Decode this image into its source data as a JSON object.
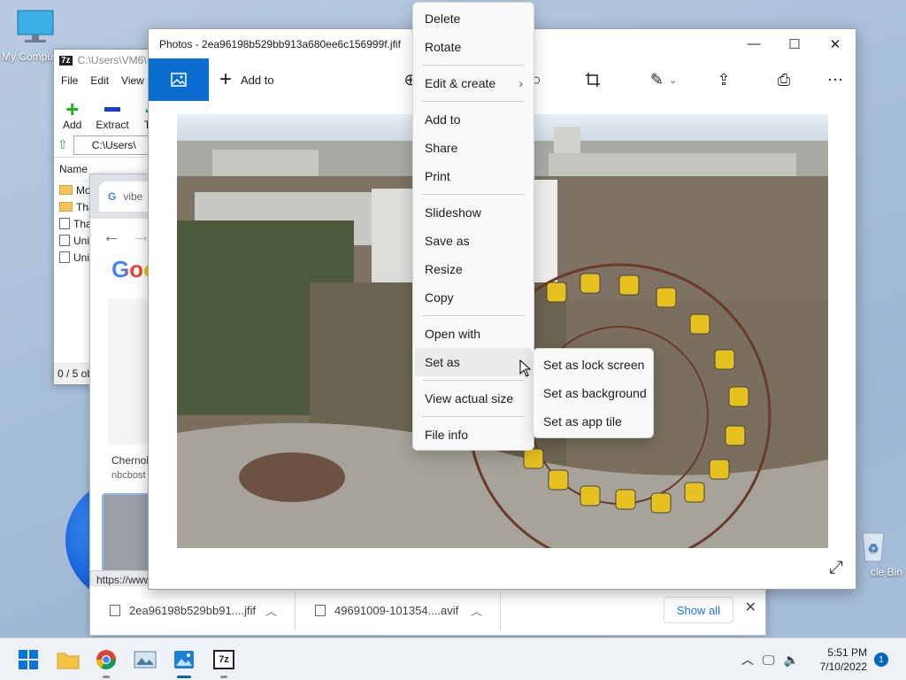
{
  "desktop": {
    "my_computer_label": "My Compu",
    "recycle_bin_label": "cle Bin"
  },
  "sevenzip": {
    "title": "C:\\Users\\VM6\\",
    "logo": "7z",
    "menu": [
      "File",
      "Edit",
      "View"
    ],
    "tools": [
      "Add",
      "Extract",
      "Te"
    ],
    "address": "C:\\Users\\",
    "column_header": "Name",
    "rows": [
      {
        "icon": "folder",
        "label": "Mo"
      },
      {
        "icon": "folder",
        "label": "Tha"
      },
      {
        "icon": "file",
        "label": "Tha"
      },
      {
        "icon": "file",
        "label": "Uni"
      },
      {
        "icon": "file",
        "label": "Uni"
      }
    ],
    "status": "0 / 5 ob"
  },
  "chrome": {
    "tab_title": "vibe",
    "google_partial": "Goo",
    "caption_title": "Chernob",
    "caption_source": "nbcbost",
    "status_url": "https://www",
    "downloads": [
      {
        "name": "2ea96198b529bb91....jfif"
      },
      {
        "name": "49691009-101354....avif"
      }
    ],
    "show_all": "Show all"
  },
  "photos": {
    "title": "Photos - 2ea96198b529bb913a680ee6c156999f.jfif",
    "add_to": "Add to",
    "toolbar_icons": [
      "zoom-icon",
      "search-icon",
      "crop-icon",
      "edit-icon",
      "share-icon",
      "print-icon",
      "more-icon"
    ]
  },
  "context_menu": {
    "items": [
      {
        "label": "Delete"
      },
      {
        "label": "Rotate"
      },
      {
        "label": "Edit & create",
        "submenu": true
      },
      {
        "label": "Add to"
      },
      {
        "label": "Share"
      },
      {
        "label": "Print"
      },
      {
        "label": "Slideshow"
      },
      {
        "label": "Save as"
      },
      {
        "label": "Resize"
      },
      {
        "label": "Copy"
      },
      {
        "label": "Open with"
      },
      {
        "label": "Set as",
        "submenu": true,
        "active": true
      },
      {
        "label": "View actual size"
      },
      {
        "label": "File info"
      }
    ],
    "submenu_items": [
      "Set as lock screen",
      "Set as background",
      "Set as app tile"
    ]
  },
  "taskbar": {
    "apps": [
      "start-icon",
      "file-explorer-icon",
      "chrome-icon",
      "photo-viewer-icon",
      "photos-icon",
      "7zip-icon"
    ],
    "time": "5:51 PM",
    "date": "7/10/2022",
    "notification_count": "1"
  },
  "colors": {
    "accent": "#0a6ed1",
    "taskbar": "#eef1f6",
    "menu_bg": "#f9f9f9"
  }
}
